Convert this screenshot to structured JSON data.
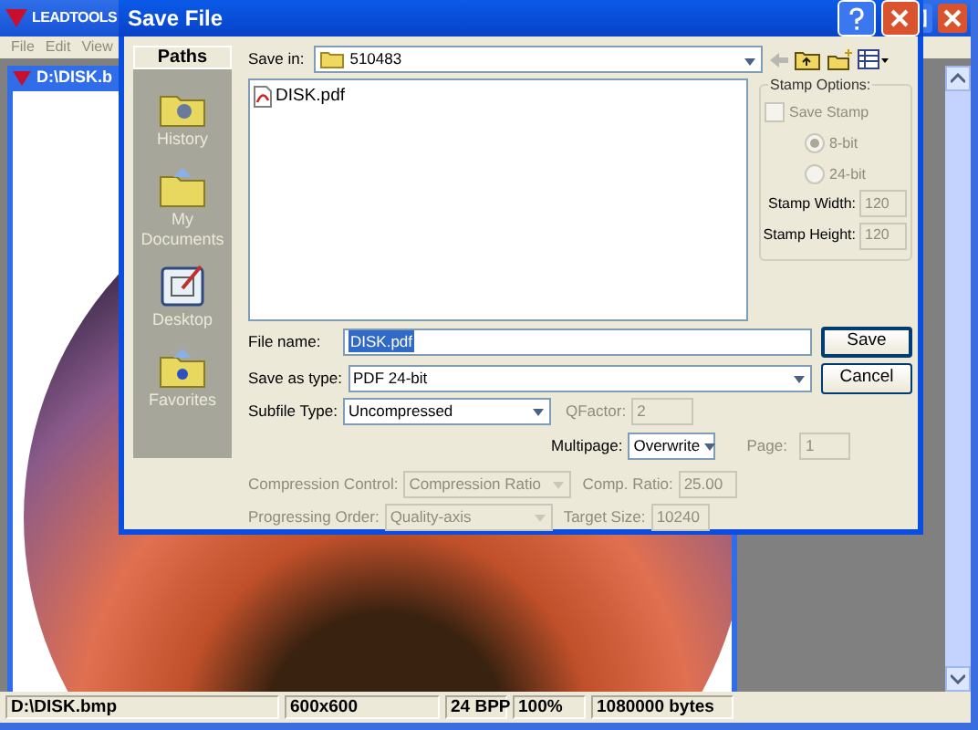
{
  "app_window": {
    "title": "LEADTOOLS"
  },
  "menu": [
    "File",
    "Edit",
    "View"
  ],
  "child_window": {
    "title": "D:\\DISK.b"
  },
  "dialog": {
    "title": "Save File",
    "places_title": "Paths",
    "places": [
      {
        "label": "History",
        "kind": "history"
      },
      {
        "label": "My Documents",
        "kind": "documents"
      },
      {
        "label": "Desktop",
        "kind": "desktop"
      },
      {
        "label": "Favorites",
        "kind": "favorites"
      }
    ],
    "save_in": {
      "label": "Save in:",
      "value": "510483"
    },
    "files": [
      {
        "name": "DISK.pdf"
      }
    ],
    "stamp_options": {
      "title": "Stamp Options:",
      "save_stamp": {
        "label": "Save Stamp",
        "checked": false,
        "disabled": true
      },
      "bits": [
        {
          "label": "8-bit",
          "selected": true,
          "disabled": true
        },
        {
          "label": "24-bit",
          "selected": false,
          "disabled": true
        }
      ],
      "stamp_width": {
        "label": "Stamp Width:",
        "value": "120",
        "disabled": true
      },
      "stamp_height": {
        "label": "Stamp Height:",
        "value": "120",
        "disabled": true
      }
    },
    "file_name": {
      "label": "File name:",
      "value": "DISK.pdf",
      "selected": true
    },
    "save_as_type": {
      "label": "Save as type:",
      "value": "PDF 24-bit"
    },
    "subfile_type": {
      "label": "Subfile Type:",
      "value": "Uncompressed",
      "disabled": false
    },
    "qfactor": {
      "label": "QFactor:",
      "value": "2",
      "disabled": true
    },
    "multipage": {
      "label": "Multipage:",
      "value": "Overwrite",
      "disabled": false
    },
    "page": {
      "label": "Page:",
      "value": "1",
      "disabled": true
    },
    "compression_control": {
      "label": "Compression Control:",
      "value": "Compression Ratio",
      "disabled": true
    },
    "comp_ratio": {
      "label": "Comp. Ratio:",
      "value": "25.00",
      "disabled": true
    },
    "progressing_order": {
      "label": "Progressing Order:",
      "value": "Quality-axis",
      "disabled": true
    },
    "target_size": {
      "label": "Target Size:",
      "value": "10240",
      "disabled": true
    },
    "buttons": [
      "Save",
      "Cancel"
    ]
  },
  "status_bar": [
    "D:\\DISK.bmp",
    "600x600",
    "24 BPP",
    "100%",
    "1080000 bytes"
  ]
}
